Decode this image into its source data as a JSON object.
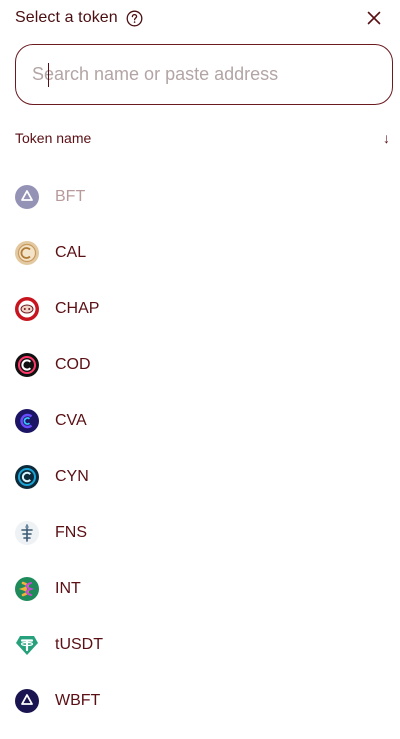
{
  "header": {
    "title": "Select a token"
  },
  "search": {
    "placeholder": "Search name or paste address",
    "value": ""
  },
  "list": {
    "column_label": "Token name",
    "sort_arrow": "↓"
  },
  "tokens": [
    {
      "symbol": "BFT",
      "icon": "bft-logo-icon",
      "disabled": true
    },
    {
      "symbol": "CAL",
      "icon": "cal-logo-icon"
    },
    {
      "symbol": "CHAP",
      "icon": "chap-logo-icon"
    },
    {
      "symbol": "COD",
      "icon": "cod-logo-icon"
    },
    {
      "symbol": "CVA",
      "icon": "cva-logo-icon"
    },
    {
      "symbol": "CYN",
      "icon": "cyn-logo-icon"
    },
    {
      "symbol": "FNS",
      "icon": "fns-logo-icon"
    },
    {
      "symbol": "INT",
      "icon": "int-logo-icon"
    },
    {
      "symbol": "tUSDT",
      "icon": "tusdt-logo-icon"
    },
    {
      "symbol": "WBFT",
      "icon": "wbft-logo-icon"
    }
  ],
  "colors": {
    "text": "#5a0f14",
    "border": "#6b1a20",
    "placeholder": "#b3a5a5",
    "disabled": "#b89a9c"
  }
}
